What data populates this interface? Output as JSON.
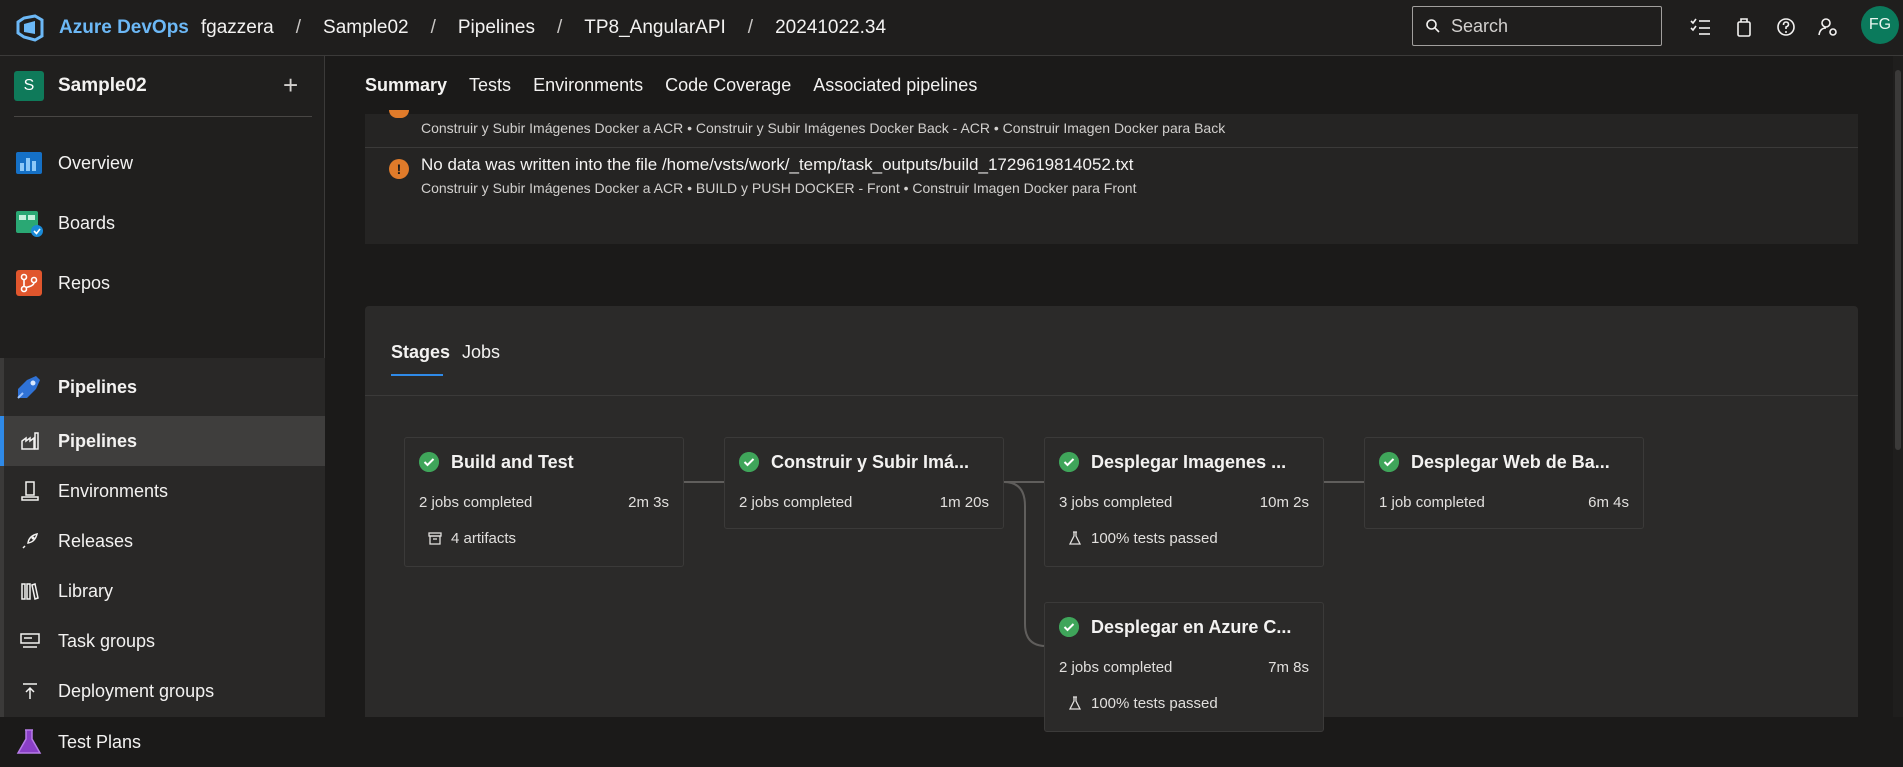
{
  "topbar": {
    "brand": "Azure DevOps",
    "breadcrumbs": [
      "fgazzera",
      "Sample02",
      "Pipelines",
      "TP8_AngularAPI",
      "20241022.34"
    ],
    "separator": "/",
    "search_placeholder": "Search",
    "avatar_initials": "FG"
  },
  "sidebar": {
    "project_initial": "S",
    "project_name": "Sample02",
    "add_label": "+",
    "items": [
      {
        "label": "Overview"
      },
      {
        "label": "Boards"
      },
      {
        "label": "Repos"
      },
      {
        "label": "Pipelines"
      },
      {
        "label": "Pipelines"
      },
      {
        "label": "Environments"
      },
      {
        "label": "Releases"
      },
      {
        "label": "Library"
      },
      {
        "label": "Task groups"
      },
      {
        "label": "Deployment groups"
      },
      {
        "label": "Test Plans"
      }
    ]
  },
  "main": {
    "tabs": [
      "Summary",
      "Tests",
      "Environments",
      "Code Coverage",
      "Associated pipelines"
    ],
    "active_tab": "Summary",
    "warnings": [
      {
        "path": "Construir y Subir Imágenes Docker a ACR • Construir y Subir Imágenes Docker Back - ACR • Construir Imagen Docker para Back"
      },
      {
        "title": "No data was written into the file /home/vsts/work/_temp/task_outputs/build_1729619814052.txt",
        "path": "Construir y Subir Imágenes Docker a ACR • BUILD y PUSH DOCKER - Front • Construir Imagen Docker para Front"
      }
    ],
    "stage_tabs": [
      "Stages",
      "Jobs"
    ],
    "stages": [
      {
        "name": "Build and Test",
        "jobs": "2 jobs completed",
        "duration": "2m 3s",
        "extra": "4 artifacts"
      },
      {
        "name": "Construir y Subir Imá...",
        "jobs": "2 jobs completed",
        "duration": "1m 20s"
      },
      {
        "name": "Desplegar Imagenes ...",
        "jobs": "3 jobs completed",
        "duration": "10m 2s",
        "extra": "100% tests passed"
      },
      {
        "name": "Desplegar Web de Ba...",
        "jobs": "1 job completed",
        "duration": "6m 4s"
      },
      {
        "name": "Desplegar en Azure C...",
        "jobs": "2 jobs completed",
        "duration": "7m 8s",
        "extra": "100% tests passed"
      }
    ]
  },
  "colors": {
    "accent": "#2f8ae8",
    "success": "#3fa55a",
    "warning": "#e07b2a",
    "brand": "#6cb8f6"
  }
}
